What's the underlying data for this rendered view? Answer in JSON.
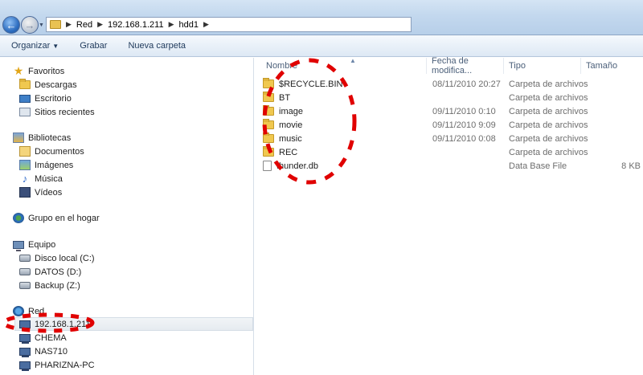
{
  "address": {
    "crumbs": [
      "Red",
      "192.168.1.211",
      "hdd1"
    ]
  },
  "toolbar": {
    "organize": "Organizar",
    "record": "Grabar",
    "new_folder": "Nueva carpeta"
  },
  "nav": {
    "favorites": "Favoritos",
    "downloads": "Descargas",
    "desktop": "Escritorio",
    "recent": "Sitios recientes",
    "libraries": "Bibliotecas",
    "documents": "Documentos",
    "images": "Imágenes",
    "music": "Música",
    "videos": "Vídeos",
    "homegroup": "Grupo en el hogar",
    "computer": "Equipo",
    "disk_c": "Disco local (C:)",
    "disk_d": "DATOS (D:)",
    "disk_z": "Backup (Z:)",
    "network": "Red",
    "net_hosts": [
      "192.168.1.211",
      "CHEMA",
      "NAS710",
      "PHARIZNA-PC"
    ]
  },
  "columns": {
    "name": "Nombre",
    "date": "Fecha de modifica...",
    "type": "Tipo",
    "size": "Tamaño"
  },
  "files": [
    {
      "name": "$RECYCLE.BIN",
      "date": "08/11/2010 20:27",
      "type": "Carpeta de archivos",
      "size": ""
    },
    {
      "name": "BT",
      "date": "",
      "type": "Carpeta de archivos",
      "size": ""
    },
    {
      "name": "image",
      "date": "09/11/2010 0:10",
      "type": "Carpeta de archivos",
      "size": ""
    },
    {
      "name": "movie",
      "date": "09/11/2010 9:09",
      "type": "Carpeta de archivos",
      "size": ""
    },
    {
      "name": "music",
      "date": "09/11/2010 0:08",
      "type": "Carpeta de archivos",
      "size": ""
    },
    {
      "name": "REC",
      "date": "",
      "type": "Carpeta de archivos",
      "size": ""
    },
    {
      "name": "thunder.db",
      "date": "",
      "type": "Data Base File",
      "size": "8 KB"
    }
  ],
  "colors": {
    "annotation": "#e00000",
    "nav_text": "#1e395b"
  }
}
